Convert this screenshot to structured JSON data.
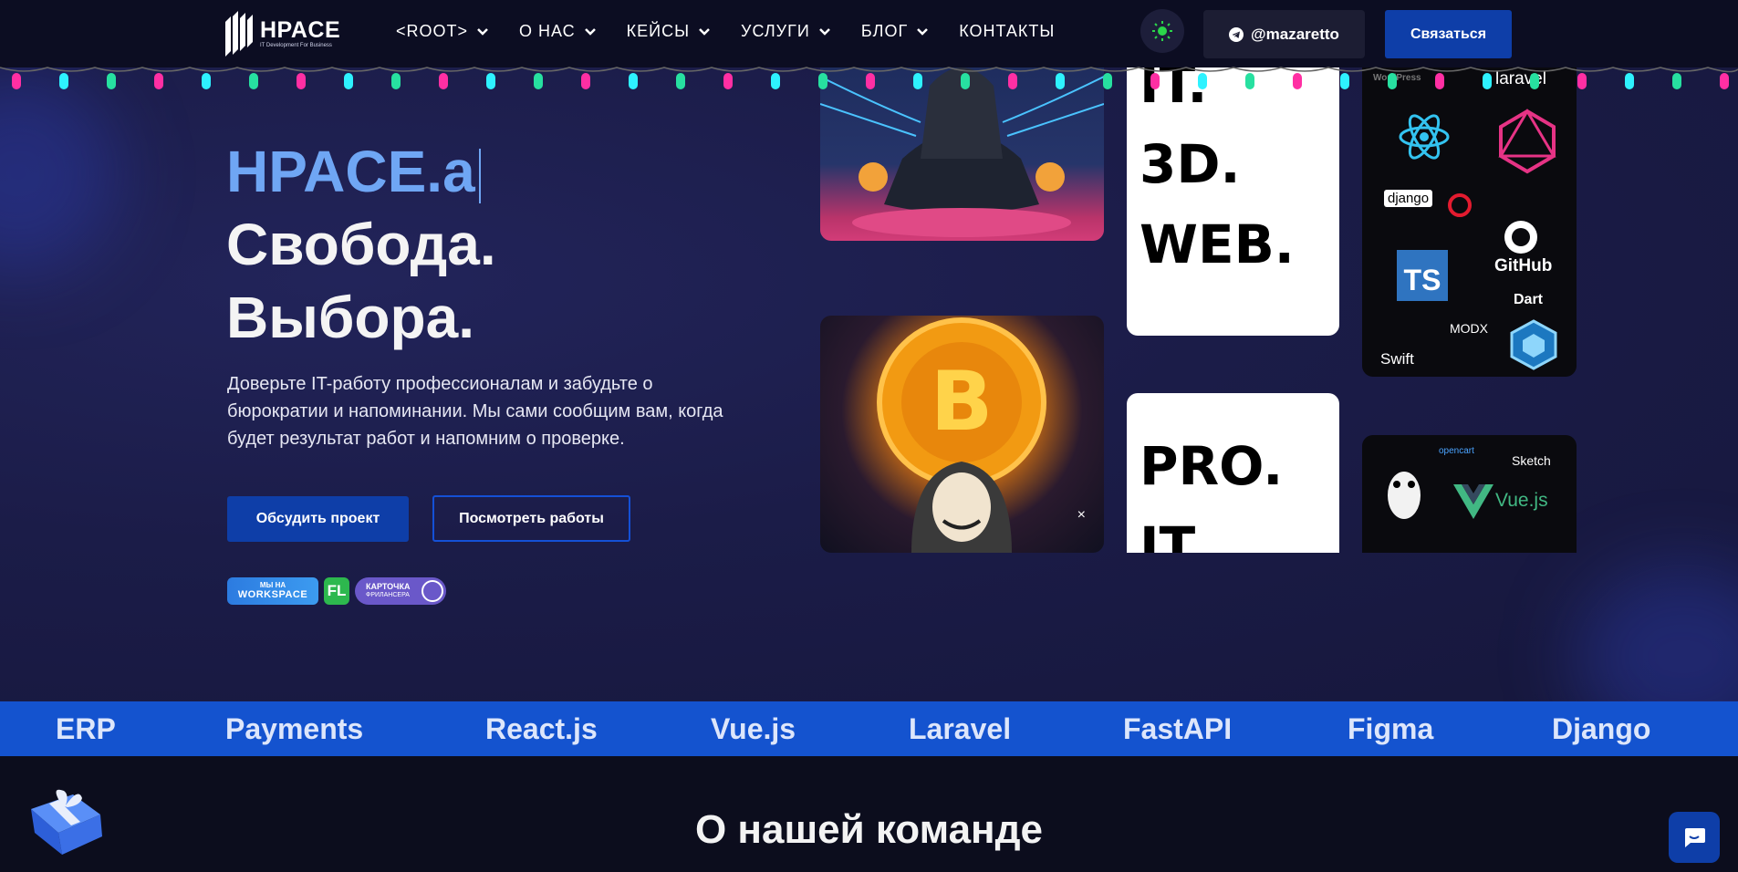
{
  "header": {
    "logo_name": "HPACE",
    "logo_tagline": "IT Development For Business",
    "nav": [
      {
        "label": "<ROOT>",
        "has_dropdown": true
      },
      {
        "label": "О НАС",
        "has_dropdown": true
      },
      {
        "label": "КЕЙСЫ",
        "has_dropdown": true
      },
      {
        "label": "УСЛУГИ",
        "has_dropdown": true
      },
      {
        "label": "БЛОГ",
        "has_dropdown": true
      },
      {
        "label": "КОНТАКТЫ",
        "has_dropdown": false
      }
    ],
    "telegram_label": "@mazaretto",
    "contact_label": "Связаться",
    "theme_icon": "sun-icon"
  },
  "hero": {
    "typed_text": "HPACE.a",
    "line2": "Свобода.",
    "line3": "Выбора.",
    "description": "Доверьте IT-работу профессионалам и забудьте о бюрократии и напоминании. Мы сами сообщим вам, когда будет результат работ и напомним о проверке.",
    "primary_button": "Обсудить проект",
    "secondary_button": "Посмотреть работы",
    "badges": {
      "workspace_top": "МЫ НА",
      "workspace_main": "WORKSPACE",
      "fl": "FL",
      "card_top": "КАРТОЧКА",
      "card_sub": "ФРИЛАНСЕРА"
    }
  },
  "gallery": {
    "tile_text_1": [
      "IT.",
      "3D.",
      "WEB."
    ],
    "tile_text_2": [
      "PRO.",
      "IT."
    ],
    "tech_logos_1": [
      "WordPress",
      "laravel",
      "django",
      "GitHub",
      "TS",
      "Dart",
      "MODX",
      "Swift"
    ],
    "tech_logos_2": [
      "opencart",
      "Sketch",
      "Vue.js"
    ],
    "close_glyph": "×"
  },
  "ticker": [
    "ERP",
    "Payments",
    "React.js",
    "Vue.js",
    "Laravel",
    "FastAPI",
    "Figma",
    "Django"
  ],
  "about": {
    "title": "О нашей команде"
  },
  "colors": {
    "background": "#1a1b45",
    "header": "#0c0d22",
    "accent_blue": "#0e3ea8",
    "accent_text": "#6fa6f4",
    "ticker": "#1453cf"
  }
}
